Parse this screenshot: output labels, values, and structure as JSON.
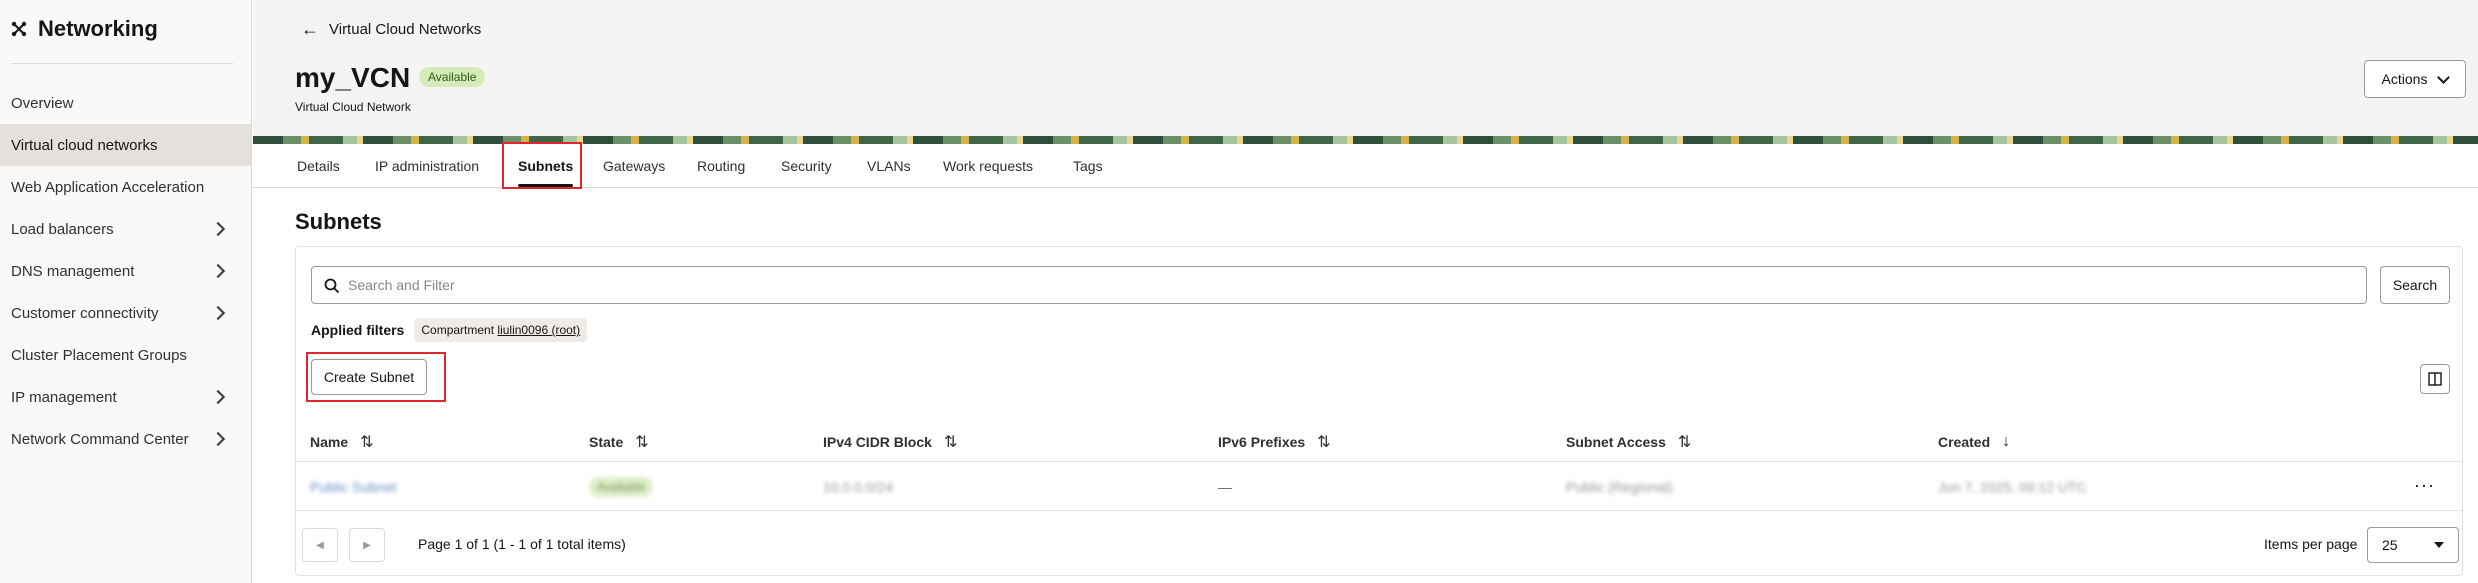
{
  "app": {
    "title": "Networking"
  },
  "sidebar": {
    "items": [
      {
        "label": "Overview",
        "has_submenu": false,
        "active": false
      },
      {
        "label": "Virtual cloud networks",
        "has_submenu": false,
        "active": true
      },
      {
        "label": "Web Application Acceleration",
        "has_submenu": false,
        "active": false
      },
      {
        "label": "Load balancers",
        "has_submenu": true,
        "active": false
      },
      {
        "label": "DNS management",
        "has_submenu": true,
        "active": false
      },
      {
        "label": "Customer connectivity",
        "has_submenu": true,
        "active": false
      },
      {
        "label": "Cluster Placement Groups",
        "has_submenu": false,
        "active": false
      },
      {
        "label": "IP management",
        "has_submenu": true,
        "active": false
      },
      {
        "label": "Network Command Center",
        "has_submenu": true,
        "active": false
      }
    ]
  },
  "header": {
    "back_label": "Virtual Cloud Networks",
    "title": "my_VCN",
    "status": "Available",
    "subtitle": "Virtual Cloud Network",
    "actions_label": "Actions"
  },
  "tabs": [
    {
      "label": "Details"
    },
    {
      "label": "IP administration"
    },
    {
      "label": "Subnets",
      "active": true
    },
    {
      "label": "Gateways"
    },
    {
      "label": "Routing"
    },
    {
      "label": "Security"
    },
    {
      "label": "VLANs"
    },
    {
      "label": "Work requests"
    },
    {
      "label": "Tags"
    }
  ],
  "main": {
    "section_title": "Subnets",
    "search_placeholder": "Search and Filter",
    "search_button": "Search",
    "applied_filters_label": "Applied filters",
    "filter_chip": {
      "key": "Compartment",
      "value": "liulin0096 (root)"
    },
    "create_button": "Create Subnet",
    "columns": [
      {
        "label": "Name",
        "sort": "⇅"
      },
      {
        "label": "State",
        "sort": "⇅"
      },
      {
        "label": "IPv4 CIDR Block",
        "sort": "⇅"
      },
      {
        "label": "IPv6 Prefixes",
        "sort": "⇅"
      },
      {
        "label": "Subnet Access",
        "sort": "⇅"
      },
      {
        "label": "Created",
        "sort": "↓"
      }
    ],
    "rows": [
      {
        "name": "Public Subnet",
        "state": "Available",
        "ipv4": "10.0.0.0/24",
        "ipv6": "—",
        "access": "Public (Regional)",
        "created": "Jun 7, 2025, 09:12 UTC"
      }
    ],
    "row_menu": "···",
    "pagination": {
      "text": "Page 1 of 1 (1 - 1 of 1 total items)",
      "items_per_page_label": "Items per page",
      "items_per_page": "25"
    }
  }
}
